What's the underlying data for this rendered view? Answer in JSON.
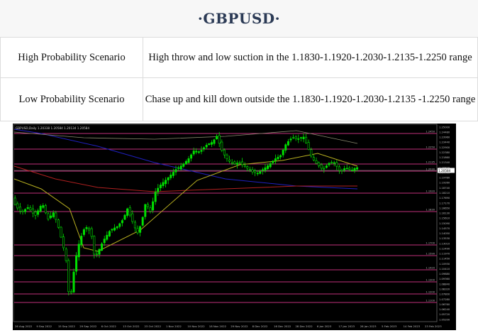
{
  "header": {
    "title": "·GBPUSD·"
  },
  "scenarios": [
    {
      "label": "High Probability Scenario",
      "value": "High throw and low suction in the 1.1830-1.1920-1.2030-1.2135-1.2250 range"
    },
    {
      "label": "Low Probability Scenario",
      "value": "Chase up and kill down outside the 1.1830-1.1920-1.2030-1.2135 -1.2250 range"
    }
  ],
  "chart": {
    "header_text": "GBPUSD,Daily  1.20338 1.20584 1.20134 1.20584",
    "colors": {
      "background": "#000000",
      "candles": "#00e000",
      "level_lines": "#c0307a",
      "ma_red": "#b02020",
      "ma_yellow": "#b8b020",
      "ma_blue": "#2020c0",
      "ma_gray": "#8a8a70",
      "current_price_line": "#9a9a9a"
    },
    "x_labels": [
      "26 Aug 2022",
      "9 Sep 2022",
      "15 Sep 2022",
      "29 Sep 2022",
      "6 Oct 2022",
      "13 Oct 2022",
      "23 Oct 2022",
      "1 Nov 2022",
      "10 Nov 2022",
      "18 Nov 2022",
      "29 Nov 2022",
      "8 Dec 2022",
      "16 Dec 2022",
      "28 Dec 2022",
      "6 Jan 2023",
      "17 Jan 2023",
      "26 Jan 2023",
      "5 Feb 2023",
      "14 Feb 2023",
      "23 Feb 2023"
    ],
    "y_labels": [
      "1.25000",
      "1.24480",
      "1.23960",
      "1.23440",
      "1.22900",
      "1.22380",
      "1.21860",
      "1.21340",
      "1.20820",
      "1.20300",
      "1.19780",
      "1.19260",
      "1.18740",
      "1.18210",
      "1.17690",
      "1.17170",
      "1.16650",
      "1.16130",
      "1.15610",
      "1.15090",
      "1.14570",
      "1.14050",
      "1.13530",
      "1.13010",
      "1.12490",
      "1.11970",
      "1.11450",
      "1.10930",
      "1.10410",
      "1.09880",
      "1.09360",
      "1.08840",
      "1.08320",
      "1.07800",
      "1.07280",
      "1.06760",
      "1.06240",
      "1.05720",
      "1.05200"
    ],
    "level_labels": [
      "1.2450",
      "1.2250",
      "1.2135",
      "1.2030",
      "1.1920",
      "1.1830",
      "1.1700",
      "1.1590",
      "1.1420",
      "1.1300",
      "1.1200",
      "1.1100"
    ],
    "current_price": "1.20584"
  }
}
